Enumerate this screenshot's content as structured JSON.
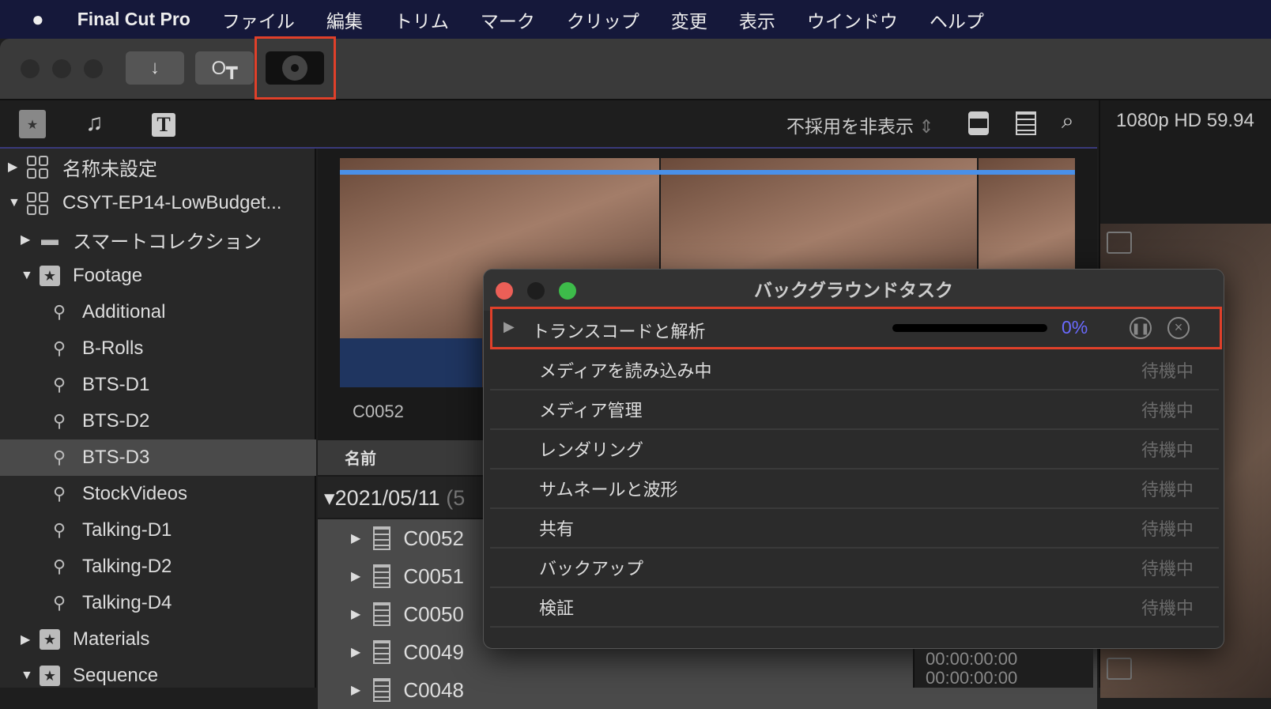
{
  "menubar": {
    "apple": "",
    "app": "Final Cut Pro",
    "items": [
      "ファイル",
      "編集",
      "トリム",
      "マーク",
      "クリップ",
      "変更",
      "表示",
      "ウインドウ",
      "ヘルプ"
    ]
  },
  "toolbar": {
    "import_icon": "↓",
    "key_icon": "key-icon",
    "bg_tasks_icon": "background-tasks-icon"
  },
  "browser_toolbar": {
    "filter": "不採用を非表示",
    "format": "1080p HD 59.94"
  },
  "sidebar": {
    "items": [
      {
        "label": "名称未設定",
        "icon": "library",
        "level": 0,
        "tri": "▶"
      },
      {
        "label": "CSYT-EP14-LowBudget...",
        "icon": "library",
        "level": 0,
        "tri": "▼"
      },
      {
        "label": "スマートコレクション",
        "icon": "folder",
        "level": 1,
        "tri": "▶"
      },
      {
        "label": "Footage",
        "icon": "event",
        "level": 1,
        "tri": "▼"
      },
      {
        "label": "Additional",
        "icon": "keyword",
        "level": 2
      },
      {
        "label": "B-Rolls",
        "icon": "keyword",
        "level": 2
      },
      {
        "label": "BTS-D1",
        "icon": "keyword",
        "level": 2
      },
      {
        "label": "BTS-D2",
        "icon": "keyword",
        "level": 2
      },
      {
        "label": "BTS-D3",
        "icon": "keyword",
        "level": 2,
        "selected": true
      },
      {
        "label": "StockVideos",
        "icon": "keyword",
        "level": 2
      },
      {
        "label": "Talking-D1",
        "icon": "keyword",
        "level": 2
      },
      {
        "label": "Talking-D2",
        "icon": "keyword",
        "level": 2
      },
      {
        "label": "Talking-D4",
        "icon": "keyword",
        "level": 2
      },
      {
        "label": "Materials",
        "icon": "event",
        "level": 1,
        "tri": "▶"
      },
      {
        "label": "Sequence",
        "icon": "event",
        "level": 1,
        "tri": "▼"
      }
    ]
  },
  "browser": {
    "thumb_label": "C0052",
    "name_header": "名前",
    "date_group": "2021/05/11",
    "date_count": "(5",
    "clips": [
      "C0052",
      "C0051",
      "C0050",
      "C0049",
      "C0048"
    ],
    "timecodes": [
      "00:00:00:00",
      "00:00:00:00"
    ]
  },
  "dialog": {
    "title": "バックグラウンドタスク",
    "active_task": {
      "label": "トランスコードと解析",
      "progress": "0%",
      "progress_value": 0
    },
    "tasks": [
      {
        "label": "メディアを読み込み中",
        "status": "待機中"
      },
      {
        "label": "メディア管理",
        "status": "待機中"
      },
      {
        "label": "レンダリング",
        "status": "待機中"
      },
      {
        "label": "サムネールと波形",
        "status": "待機中"
      },
      {
        "label": "共有",
        "status": "待機中"
      },
      {
        "label": "バックアップ",
        "status": "待機中"
      },
      {
        "label": "検証",
        "status": "待機中"
      }
    ]
  },
  "colors": {
    "highlight": "#e0402a",
    "progress_text": "#6a6aff",
    "menubar": "#15183a"
  }
}
